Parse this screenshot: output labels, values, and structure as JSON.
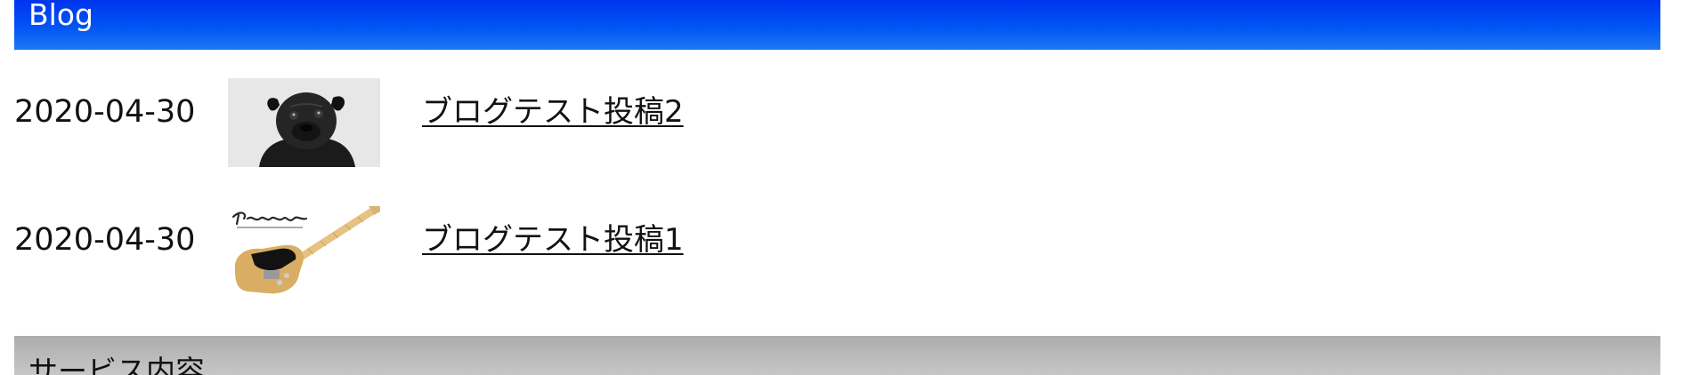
{
  "blog": {
    "title": "Blog",
    "posts": [
      {
        "date": "2020-04-30",
        "title": "ブログテスト投稿2",
        "thumbnail": "pug-dog-photo"
      },
      {
        "date": "2020-04-30",
        "title": "ブログテスト投稿1",
        "thumbnail": "fender-guitar-photo"
      }
    ]
  },
  "services": {
    "title": "サービス内容"
  },
  "colors": {
    "blog_header": "#0040f2",
    "service_header": "#b5b5b5",
    "text": "#111111"
  }
}
